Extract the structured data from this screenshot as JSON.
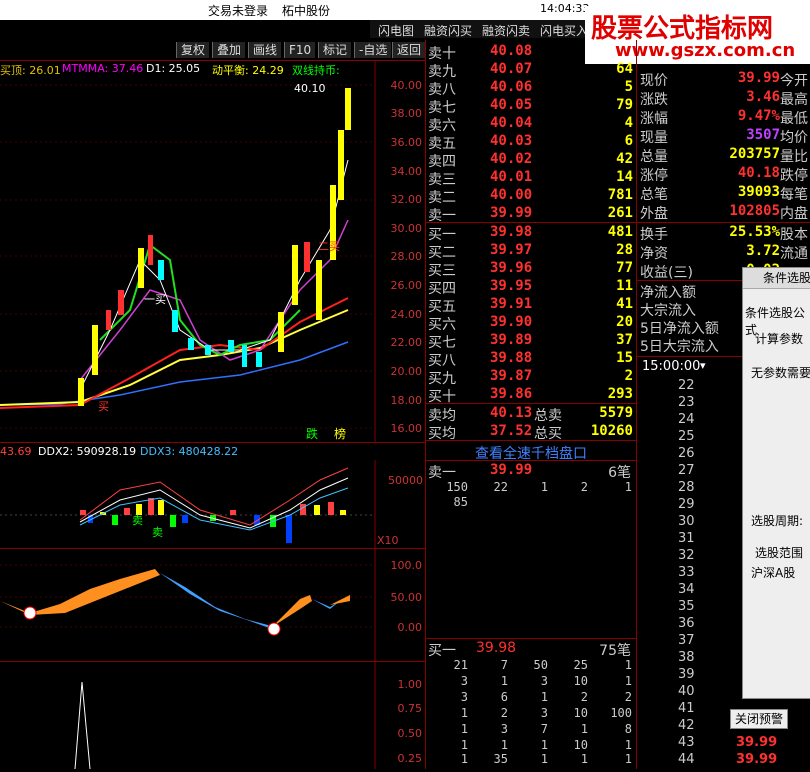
{
  "window": {
    "title_left": "交易未登录",
    "title_right": "柘中股份",
    "time": "14:04:33"
  },
  "top_nav": [
    "闪电图",
    "融资闪买",
    "融资闪卖",
    "闪电买入"
  ],
  "toolbar": [
    "复权",
    "叠加",
    "画线",
    "F10",
    "标记",
    "-自选",
    "返回"
  ],
  "chart_header": [
    {
      "text": "买顶: 26.01",
      "color": "#e0c000"
    },
    {
      "text": "MTMMA: 37.46",
      "color": "#ff00ff"
    },
    {
      "text": "D1: 25.05",
      "color": "#ffffff"
    },
    {
      "text": "动平衡: 24.29",
      "color": "#ffff00"
    },
    {
      "text": "双线持币:",
      "color": "#00ff00"
    }
  ],
  "price_axis": [
    "40.00",
    "38.00",
    "36.00",
    "34.00",
    "32.00",
    "30.00",
    "28.00",
    "26.00",
    "24.00",
    "22.00",
    "20.00",
    "18.00",
    "16.00"
  ],
  "high_label": "40.10",
  "chart_marks": {
    "buy1": "一买",
    "buy2": "买",
    "sell": "卖",
    "mark_buy": "二买",
    "tag1": "跌",
    "tag2": "榜"
  },
  "ddx": {
    "ddx1": "43.69",
    "ddx2_label": "DDX2: 590928.19",
    "ddx3_label": "DDX3: 480428.22",
    "axis": "50000",
    "x10": "X10"
  },
  "osc_axis": [
    "100.0",
    "50.00",
    "0.00"
  ],
  "bottom_axis": [
    "1.00",
    "0.75",
    "0.50",
    "0.25"
  ],
  "asks": [
    {
      "label": "卖十",
      "price": "40.08",
      "vol": ""
    },
    {
      "label": "卖九",
      "price": "40.07",
      "vol": "64"
    },
    {
      "label": "卖八",
      "price": "40.06",
      "vol": "5"
    },
    {
      "label": "卖七",
      "price": "40.05",
      "vol": "79"
    },
    {
      "label": "卖六",
      "price": "40.04",
      "vol": "4"
    },
    {
      "label": "卖五",
      "price": "40.03",
      "vol": "6"
    },
    {
      "label": "卖四",
      "price": "40.02",
      "vol": "42"
    },
    {
      "label": "卖三",
      "price": "40.01",
      "vol": "14"
    },
    {
      "label": "卖二",
      "price": "40.00",
      "vol": "781"
    },
    {
      "label": "卖一",
      "price": "39.99",
      "vol": "261"
    }
  ],
  "bids": [
    {
      "label": "买一",
      "price": "39.98",
      "vol": "481"
    },
    {
      "label": "买二",
      "price": "39.97",
      "vol": "28"
    },
    {
      "label": "买三",
      "price": "39.96",
      "vol": "77"
    },
    {
      "label": "买四",
      "price": "39.95",
      "vol": "11"
    },
    {
      "label": "买五",
      "price": "39.91",
      "vol": "41"
    },
    {
      "label": "买六",
      "price": "39.90",
      "vol": "20"
    },
    {
      "label": "买七",
      "price": "39.89",
      "vol": "37"
    },
    {
      "label": "买八",
      "price": "39.88",
      "vol": "15"
    },
    {
      "label": "买九",
      "price": "39.87",
      "vol": "2"
    },
    {
      "label": "买十",
      "price": "39.86",
      "vol": "293"
    }
  ],
  "avg": {
    "sell_avg_label": "卖均",
    "sell_avg": "40.13",
    "total_sell_label": "总卖",
    "total_sell": "5579",
    "buy_avg_label": "买均",
    "buy_avg": "37.52",
    "total_buy_label": "总买",
    "total_buy": "10260"
  },
  "depth": {
    "title": "查看全速千档盘口",
    "ask_label": "卖一",
    "ask_price": "39.99",
    "ask_count": "6笔",
    "ask_rows": [
      [
        "150",
        "22",
        "1",
        "2",
        "1"
      ],
      [
        "85",
        "",
        "",
        "",
        ""
      ]
    ],
    "bid_label": "买一",
    "bid_price": "39.98",
    "bid_count": "75笔",
    "bid_rows": [
      [
        "21",
        "7",
        "50",
        "25",
        "1"
      ],
      [
        "3",
        "1",
        "3",
        "10",
        "1"
      ],
      [
        "3",
        "6",
        "1",
        "2",
        "2"
      ],
      [
        "1",
        "2",
        "3",
        "10",
        "100"
      ],
      [
        "1",
        "3",
        "7",
        "1",
        "8"
      ],
      [
        "1",
        "1",
        "1",
        "10",
        "1"
      ],
      [
        "1",
        "35",
        "1",
        "1",
        "1"
      ]
    ]
  },
  "stats": [
    {
      "label": "现价",
      "val": "39.99",
      "color": "#ff3030",
      "label2": "今开"
    },
    {
      "label": "涨跌",
      "val": "3.46",
      "color": "#ff3030",
      "label2": "最高"
    },
    {
      "label": "涨幅",
      "val": "9.47%",
      "color": "#ff3030",
      "label2": "最低"
    },
    {
      "label": "现量",
      "val": "3507",
      "color": "#c040ff",
      "label2": "均价"
    },
    {
      "label": "总量",
      "val": "203757",
      "color": "#ffff00",
      "label2": "量比"
    },
    {
      "label": "涨停",
      "val": "40.18",
      "color": "#ff3030",
      "label2": "跌停"
    },
    {
      "label": "总笔",
      "val": "39093",
      "color": "#ffff00",
      "label2": "每笔"
    },
    {
      "label": "外盘",
      "val": "102805",
      "color": "#ff3030",
      "label2": "内盘"
    }
  ],
  "stats2": [
    {
      "label": "换手",
      "val": "25.53%",
      "color": "#ffff00",
      "label2": "股本"
    },
    {
      "label": "净资",
      "val": "3.72",
      "color": "#ffff00",
      "label2": "流通"
    },
    {
      "label": "收益(三)",
      "val": "0.02",
      "color": "#ffff00",
      "label2": ""
    }
  ],
  "flow": [
    "净流入额",
    "大宗流入",
    "5日净流入额",
    "5日大宗流入"
  ],
  "ticks": {
    "time": "15:00:00",
    "nums": [
      "22",
      "23",
      "24",
      "25",
      "26",
      "27",
      "28",
      "29",
      "30",
      "31",
      "32",
      "33",
      "34",
      "35",
      "36",
      "37",
      "38",
      "39",
      "40",
      "41",
      "42",
      "43",
      "44"
    ],
    "last_prices": [
      "39.99",
      "39.99"
    ]
  },
  "dialog": {
    "title": "条件选股",
    "head": "条件选股公式",
    "params": "计算参数",
    "noparam": "无参数需要",
    "period": "选股周期:",
    "range_title": "选股范围",
    "range": "沪深A股",
    "close": "关闭预警"
  },
  "watermark": {
    "line1": "股票公式指标网",
    "line2": "www.gszx.com.cn"
  }
}
